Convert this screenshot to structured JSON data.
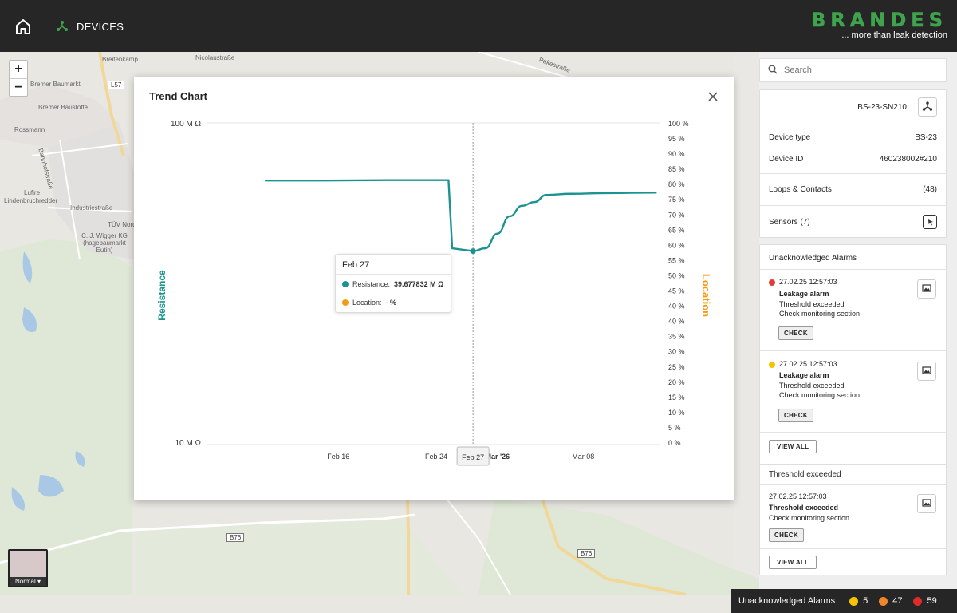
{
  "header": {
    "devices_label": "DEVICES",
    "brand_name": "BRANDES",
    "brand_tagline": "... more than leak detection",
    "brand_color": "#3fa34d"
  },
  "map": {
    "labels": [
      "Breitenkamp",
      "Nicolaustraße",
      "Bremer Baumarkt",
      "Bremer Baustoffe",
      "Rossmann",
      "Lufire",
      "Lindenbruchredder",
      "Industriestraße",
      "TÜV Nord",
      "C. J. Wigger KG (hagebaumarkt Eutin)",
      "Pakestraße",
      "Bahnhofstraße"
    ],
    "road_tags": [
      "L57",
      "B76",
      "B76"
    ],
    "layer_switch_label": "Normal"
  },
  "trend_chart": {
    "title": "Trend Chart",
    "tooltip": {
      "date": "Feb 27",
      "resistance_label": "Resistance:",
      "resistance_value": "39.677832 M Ω",
      "location_label": "Location:",
      "location_value": "- %"
    }
  },
  "chart_data": {
    "type": "line",
    "title": "Trend Chart",
    "ylabel_left": "Resistance",
    "ylabel_right": "Location",
    "left_axis_ticks": [
      "100 M Ω",
      "10 M Ω"
    ],
    "right_axis_ticks": [
      "100 %",
      "95 %",
      "90 %",
      "85 %",
      "80 %",
      "75 %",
      "70 %",
      "65 %",
      "60 %",
      "55 %",
      "50 %",
      "45 %",
      "40 %",
      "40 %",
      "35 %",
      "30 %",
      "25 %",
      "20 %",
      "15 %",
      "10 %",
      "5 %",
      "0 %"
    ],
    "x_ticks": [
      "Feb 16",
      "Feb 24",
      "Feb 27",
      "Mar '26",
      "Mar 08"
    ],
    "ylim": [
      10,
      100
    ],
    "yscale": "log",
    "right_ylim": [
      0,
      100
    ],
    "series": [
      {
        "name": "Resistance",
        "color": "#1a9391",
        "points": [
          {
            "x": "Feb 10",
            "y": 66.0
          },
          {
            "x": "Feb 15",
            "y": 66.0
          },
          {
            "x": "Feb 20",
            "y": 66.2
          },
          {
            "x": "Feb 25",
            "y": 66.2
          },
          {
            "x": "Feb 25.3",
            "y": 40.5
          },
          {
            "x": "Feb 27",
            "y": 39.68
          },
          {
            "x": "Feb 28",
            "y": 40.5
          },
          {
            "x": "Mar 01",
            "y": 45.0
          },
          {
            "x": "Mar 02",
            "y": 51.0
          },
          {
            "x": "Mar 03",
            "y": 55.0
          },
          {
            "x": "Mar 04",
            "y": 56.5
          },
          {
            "x": "Mar 05",
            "y": 59.5
          },
          {
            "x": "Mar 07",
            "y": 60.0
          },
          {
            "x": "Mar 10",
            "y": 60.3
          },
          {
            "x": "Mar 14",
            "y": 60.5
          }
        ]
      }
    ],
    "location_color": "#f39c12",
    "cursor_x": "Feb 27"
  },
  "panel": {
    "search_placeholder": "Search",
    "device_name": "BS-23-SN210",
    "device_type_label": "Device type",
    "device_type_value": "BS-23",
    "device_id_label": "Device ID",
    "device_id_value": "460238002#210",
    "loops_label": "Loops & Contacts",
    "loops_value": "(48)",
    "sensors_label": "Sensors (7)",
    "unack_title": "Unacknowledged Alarms",
    "alarms": [
      {
        "time": "27.02.25 12:57:03",
        "title": "Leakage alarm",
        "line1": "Threshold exceeded",
        "line2": "Check monitoring section",
        "color": "#e53935",
        "button": "CHECK"
      },
      {
        "time": "27.02.25 12:57:03",
        "title": "Leakage alarm",
        "line1": "Threshold exceeded",
        "line2": "Check monitoring section",
        "color": "#f5c400",
        "button": "CHECK"
      }
    ],
    "view_all": "VIEW ALL",
    "thresh_title": "Threshold exceeded",
    "thresh_item": {
      "time": "27.02.25 12:57:03",
      "title": "Threshold exceeded",
      "line1": "Check monitoring section",
      "button": "CHECK"
    },
    "thresh_view_all": "VIEW ALL"
  },
  "status": {
    "label": "Unacknowledged Alarms",
    "yellow_count": "5",
    "orange_count": "47",
    "red_count": "59",
    "yellow": "#f5c400",
    "orange": "#f0862a",
    "red": "#e02b2b"
  }
}
